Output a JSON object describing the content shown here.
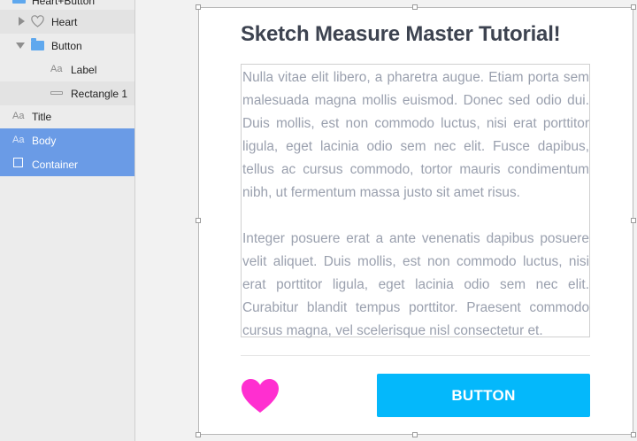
{
  "layers": {
    "items": [
      {
        "label": "Heart+Button"
      },
      {
        "label": "Heart"
      },
      {
        "label": "Button"
      },
      {
        "label": "Label",
        "icon_text": "Aa"
      },
      {
        "label": "Rectangle 1"
      },
      {
        "label": "Title",
        "icon_text": "Aa"
      },
      {
        "label": "Body",
        "icon_text": "Aa"
      },
      {
        "label": "Container"
      }
    ],
    "selected_color": "#6a9be6"
  },
  "artboard": {
    "title": "Sketch Measure Master Tutorial!",
    "paragraphs": [
      "Nulla vitae elit libero, a pharetra augue. Etiam porta sem malesuada magna mollis euismod. Donec sed odio dui. Duis mollis, est non commodo luctus, nisi erat porttitor ligula, eget lacinia odio sem nec elit. Fusce dapibus, tellus ac cursus commodo, tortor mauris condimentum nibh, ut fermentum massa justo sit amet risus.",
      "Integer posuere erat a ante venenatis dapibus posuere velit aliquet. Duis mollis, est non commodo luctus, nisi erat porttitor ligula, eget lacinia odio sem nec elit. Curabitur blandit tempus porttitor. Praesent commodo cursus magna, vel scelerisque nisl consectetur et."
    ],
    "button_label": "BUTTON",
    "heart_color": "#ff2fd0",
    "button_color": "#04b8fb"
  }
}
